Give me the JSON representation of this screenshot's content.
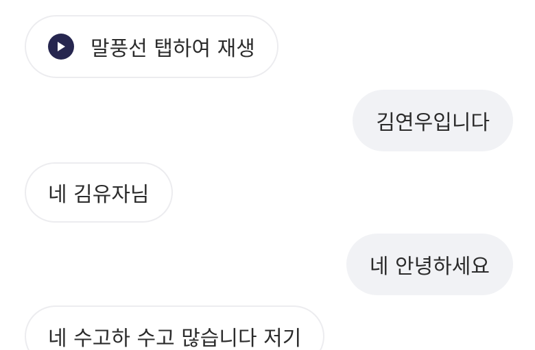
{
  "messages": [
    {
      "side": "left",
      "text": "말풍선 탭하여 재생",
      "icon": "play-icon"
    },
    {
      "side": "right",
      "text": "김연우입니다"
    },
    {
      "side": "left",
      "text": "네 김유자님"
    },
    {
      "side": "right",
      "text": "네 안녕하세요"
    },
    {
      "side": "left",
      "text": "네 수고하 수고 많습니다 저기"
    }
  ],
  "colors": {
    "play_icon_bg": "#26264f",
    "outgoing_bubble_bg": "#f1f2f5",
    "incoming_bubble_border": "#ececef",
    "text": "#2b2b2b"
  }
}
